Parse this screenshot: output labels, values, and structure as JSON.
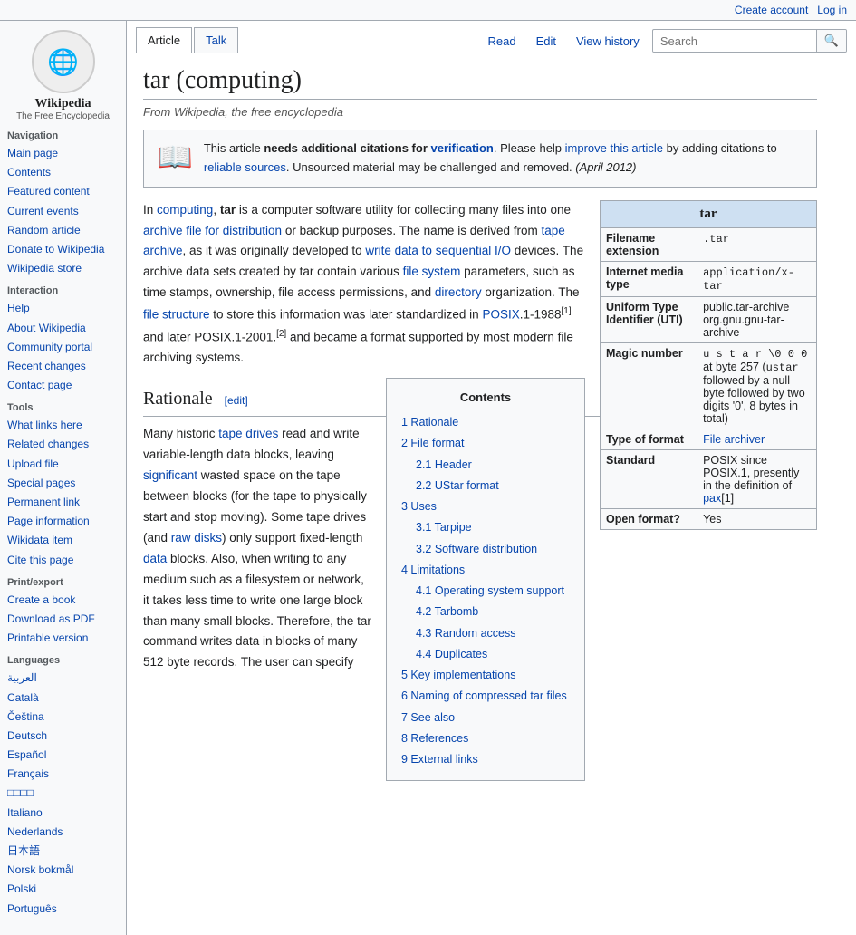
{
  "topbar": {
    "create_account": "Create account",
    "log_in": "Log in"
  },
  "sidebar": {
    "logo_text": "🌐",
    "logo_title": "Wikipedia",
    "logo_subtitle": "The Free Encyclopedia",
    "nav_section": {
      "title": "Navigation",
      "items": [
        {
          "label": "Main page",
          "href": "#"
        },
        {
          "label": "Contents",
          "href": "#"
        },
        {
          "label": "Featured content",
          "href": "#"
        },
        {
          "label": "Current events",
          "href": "#"
        },
        {
          "label": "Random article",
          "href": "#"
        },
        {
          "label": "Donate to Wikipedia",
          "href": "#"
        },
        {
          "label": "Wikipedia store",
          "href": "#"
        }
      ]
    },
    "interaction_section": {
      "title": "Interaction",
      "items": [
        {
          "label": "Help",
          "href": "#"
        },
        {
          "label": "About Wikipedia",
          "href": "#"
        },
        {
          "label": "Community portal",
          "href": "#"
        },
        {
          "label": "Recent changes",
          "href": "#"
        },
        {
          "label": "Contact page",
          "href": "#"
        }
      ]
    },
    "tools_section": {
      "title": "Tools",
      "items": [
        {
          "label": "What links here",
          "href": "#"
        },
        {
          "label": "Related changes",
          "href": "#"
        },
        {
          "label": "Upload file",
          "href": "#"
        },
        {
          "label": "Special pages",
          "href": "#"
        },
        {
          "label": "Permanent link",
          "href": "#"
        },
        {
          "label": "Page information",
          "href": "#"
        },
        {
          "label": "Wikidata item",
          "href": "#"
        },
        {
          "label": "Cite this page",
          "href": "#"
        }
      ]
    },
    "print_section": {
      "title": "Print/export",
      "items": [
        {
          "label": "Create a book",
          "href": "#"
        },
        {
          "label": "Download as PDF",
          "href": "#"
        },
        {
          "label": "Printable version",
          "href": "#"
        }
      ]
    },
    "languages_section": {
      "title": "Languages",
      "items": [
        {
          "label": "العربية",
          "href": "#"
        },
        {
          "label": "Català",
          "href": "#"
        },
        {
          "label": "Čeština",
          "href": "#"
        },
        {
          "label": "Deutsch",
          "href": "#"
        },
        {
          "label": "Español",
          "href": "#"
        },
        {
          "label": "Français",
          "href": "#"
        },
        {
          "label": "□□□□",
          "href": "#"
        },
        {
          "label": "Italiano",
          "href": "#"
        },
        {
          "label": "Nederlands",
          "href": "#"
        },
        {
          "label": "日本語",
          "href": "#"
        },
        {
          "label": "Norsk bokmål",
          "href": "#"
        },
        {
          "label": "Polski",
          "href": "#"
        },
        {
          "label": "Português",
          "href": "#"
        }
      ]
    }
  },
  "tabs": {
    "article": "Article",
    "talk": "Talk",
    "read": "Read",
    "edit": "Edit",
    "view_history": "View history"
  },
  "search": {
    "placeholder": "Search",
    "button": "🔍"
  },
  "article": {
    "title": "tar (computing)",
    "subtitle": "From Wikipedia, the free encyclopedia",
    "notice": {
      "icon": "📖",
      "text_before": "This article ",
      "bold": "needs additional citations for",
      "link1": "verification",
      "text2": ". Please help ",
      "link2": "improve this article",
      "text3": " by adding citations to ",
      "link3": "reliable sources",
      "text4": ". Unsourced material may be challenged and removed. ",
      "date": "(April 2012)"
    },
    "infobox": {
      "title": "tar",
      "rows": [
        {
          "label": "Filename extension",
          "value": ".tar"
        },
        {
          "label": "Internet media type",
          "value": "application/x-tar"
        },
        {
          "label": "Uniform Type Identifier (UTI)",
          "value": "public.tar-archive org.gnu.gnu-tar-archive"
        },
        {
          "label": "Magic number",
          "value": "u s t a r \\0 0 0 at byte 257 (ustar followed by a null byte followed by two digits '0', 8 bytes in total)"
        },
        {
          "label": "Type of format",
          "value": "File archiver",
          "link": true
        },
        {
          "label": "Standard",
          "value": "POSIX since POSIX.1, presently in the definition of pax[1]"
        },
        {
          "label": "Open format?",
          "value": "Yes"
        }
      ]
    },
    "intro_text": "In computing, tar is a computer software utility for collecting many files into one archive file for distribution or backup purposes. The name is derived from tape archive, as it was originally developed to write data to sequential I/O devices. The archive data sets created by tar contain various file system parameters, such as time stamps, ownership, file access permissions, and directory organization. The file structure to store this information was later standardized in POSIX.1-1988[1] and later POSIX.1-2001.[2] and became a format supported by most modern file archiving systems.",
    "toc": {
      "title": "Contents",
      "items": [
        {
          "num": "1",
          "label": "Rationale",
          "sub": []
        },
        {
          "num": "2",
          "label": "File format",
          "sub": [
            {
              "num": "2.1",
              "label": "Header"
            },
            {
              "num": "2.2",
              "label": "UStar format"
            }
          ]
        },
        {
          "num": "3",
          "label": "Uses",
          "sub": [
            {
              "num": "3.1",
              "label": "Tarpipe"
            },
            {
              "num": "3.2",
              "label": "Software distribution"
            }
          ]
        },
        {
          "num": "4",
          "label": "Limitations",
          "sub": [
            {
              "num": "4.1",
              "label": "Operating system support"
            },
            {
              "num": "4.2",
              "label": "Tarbomb"
            },
            {
              "num": "4.3",
              "label": "Random access"
            },
            {
              "num": "4.4",
              "label": "Duplicates"
            }
          ]
        },
        {
          "num": "5",
          "label": "Key implementations",
          "sub": []
        },
        {
          "num": "6",
          "label": "Naming of compressed tar files",
          "sub": []
        },
        {
          "num": "7",
          "label": "See also",
          "sub": []
        },
        {
          "num": "8",
          "label": "References",
          "sub": []
        },
        {
          "num": "9",
          "label": "External links",
          "sub": []
        }
      ]
    },
    "rationale_heading": "Rationale",
    "rationale_edit": "[edit]",
    "rationale_text": "Many historic tape drives read and write variable-length data blocks, leaving significant wasted space on the tape between blocks (for the tape to physically start and stop moving). Some tape drives (and raw disks) only support fixed-length data blocks. Also, when writing to any medium such as a filesystem or network, it takes less time to write one large block than many small blocks. Therefore, the tar command writes data in blocks of many 512 byte records. The user can specify"
  }
}
